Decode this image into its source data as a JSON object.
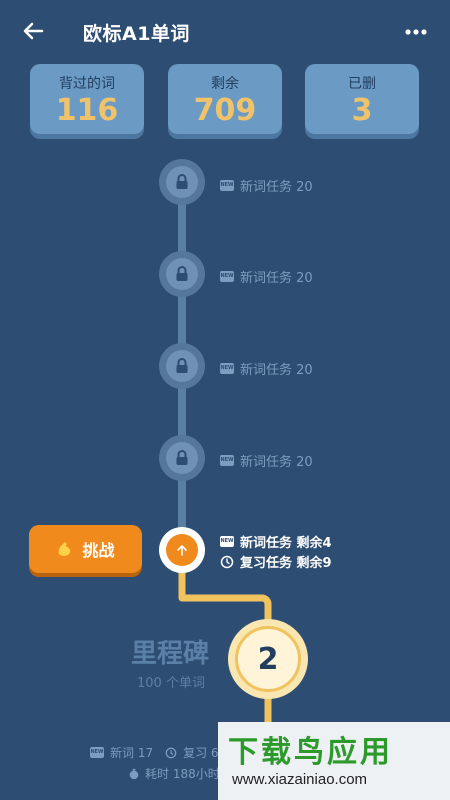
{
  "header": {
    "title": "欧标A1单词",
    "back_icon": "arrow-left-icon",
    "more_icon": "more-dots-icon"
  },
  "stats": [
    {
      "label": "背过的词",
      "value": "116"
    },
    {
      "label": "剩余",
      "value": "709"
    },
    {
      "label": "已删",
      "value": "3"
    }
  ],
  "locked_tasks": [
    {
      "label": "新词任务 20"
    },
    {
      "label": "新词任务 20"
    },
    {
      "label": "新词任务 20"
    },
    {
      "label": "新词任务 20"
    }
  ],
  "current": {
    "challenge_label": "挑战",
    "new_task": "新词任务 剩余4",
    "review_task": "复习任务 剩余9"
  },
  "milestone": {
    "title": "里程碑",
    "subtitle": "100 个单词",
    "number": "2"
  },
  "bottom": {
    "new_words": "新词 17",
    "review": "复习 6",
    "time": "耗时 188小时"
  },
  "watermark": {
    "title": "下载鸟应用",
    "url": "www.xiazainiao.com"
  },
  "colors": {
    "background": "#2e4d72",
    "card": "#6b9ac4",
    "accent_orange": "#f08a1c",
    "gold": "#f0c36b"
  }
}
